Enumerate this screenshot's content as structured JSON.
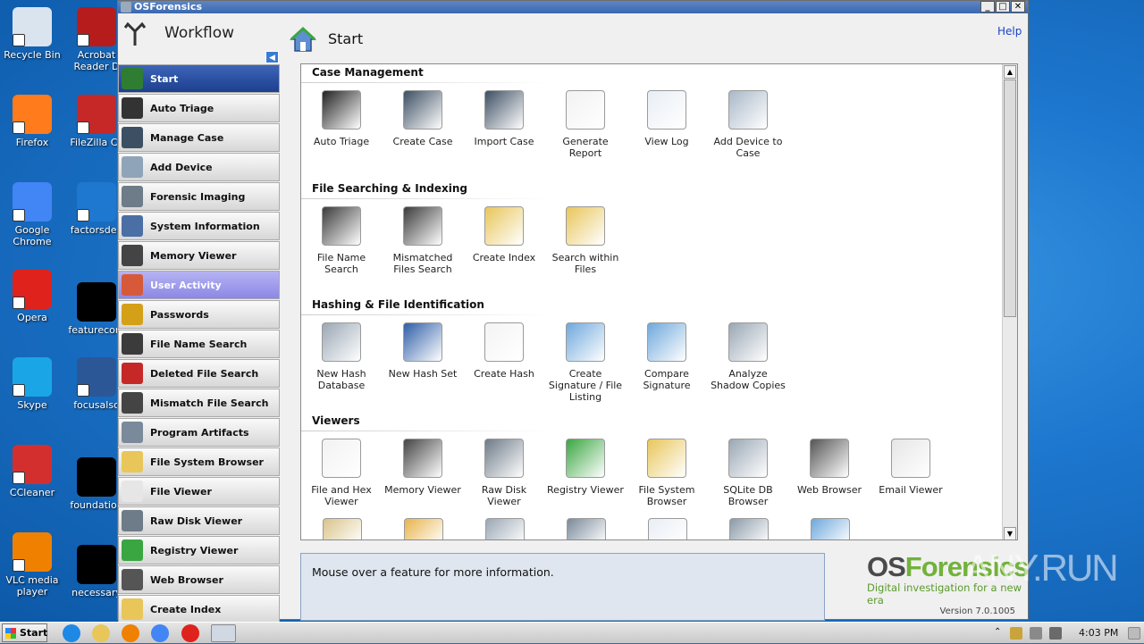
{
  "desktop": {
    "icons": [
      {
        "label": "Recycle Bin",
        "icon": "recycle-bin-icon",
        "color": "#d9e4ef"
      },
      {
        "label": "Acrobat Reader D",
        "icon": "acrobat-icon",
        "color": "#b71c1c"
      },
      {
        "label": "Firefox",
        "icon": "firefox-icon",
        "color": "#ff7b1b"
      },
      {
        "label": "FileZilla Cli",
        "icon": "filezilla-icon",
        "color": "#c62828"
      },
      {
        "label": "Google Chrome",
        "icon": "chrome-icon",
        "color": "#4285f4"
      },
      {
        "label": "factorsdee",
        "icon": "file-icon",
        "color": "#1e78cf"
      },
      {
        "label": "Opera",
        "icon": "opera-icon",
        "color": "#e0221c"
      },
      {
        "label": "featurecom",
        "icon": "file-icon",
        "color": "#000000"
      },
      {
        "label": "Skype",
        "icon": "skype-icon",
        "color": "#1aa6e6"
      },
      {
        "label": "focusalso",
        "icon": "word-document-icon",
        "color": "#2b5797"
      },
      {
        "label": "CCleaner",
        "icon": "ccleaner-icon",
        "color": "#d32f2f"
      },
      {
        "label": "foundation",
        "icon": "file-icon",
        "color": "#000000"
      },
      {
        "label": "VLC media player",
        "icon": "vlc-icon",
        "color": "#f08000"
      },
      {
        "label": "necessary",
        "icon": "file-icon",
        "color": "#000000"
      }
    ]
  },
  "window": {
    "title": "OSForensics",
    "buttons": {
      "minimize": "_",
      "maximize": "□",
      "close": "✕"
    }
  },
  "sidebar": {
    "title": "Workflow",
    "collapse_glyph": "◀",
    "items": [
      {
        "label": "Start",
        "state": "selected",
        "icon": "home-icon",
        "color": "#2e7d32"
      },
      {
        "label": "Auto Triage",
        "state": "normal",
        "icon": "fingerprint-icon",
        "color": "#333333"
      },
      {
        "label": "Manage Case",
        "state": "normal",
        "icon": "briefcase-icon",
        "color": "#3d4f63"
      },
      {
        "label": "Add Device",
        "state": "normal",
        "icon": "disc-icon",
        "color": "#8fa4b8"
      },
      {
        "label": "Forensic Imaging",
        "state": "normal",
        "icon": "drive-icon",
        "color": "#6e7b88"
      },
      {
        "label": "System Information",
        "state": "normal",
        "icon": "system-info-icon",
        "color": "#4a6fa5"
      },
      {
        "label": "Memory Viewer",
        "state": "normal",
        "icon": "memory-chip-icon",
        "color": "#444444"
      },
      {
        "label": "User Activity",
        "state": "hover",
        "icon": "user-activity-icon",
        "color": "#d65a3a"
      },
      {
        "label": "Passwords",
        "state": "normal",
        "icon": "key-icon",
        "color": "#d4a017"
      },
      {
        "label": "File Name Search",
        "state": "normal",
        "icon": "binoculars-icon",
        "color": "#3b3b3b"
      },
      {
        "label": "Deleted File Search",
        "state": "normal",
        "icon": "deleted-file-icon",
        "color": "#c62828"
      },
      {
        "label": "Mismatch File Search",
        "state": "normal",
        "icon": "mismatch-icon",
        "color": "#444444"
      },
      {
        "label": "Program Artifacts",
        "state": "normal",
        "icon": "artifacts-icon",
        "color": "#7a8a9a"
      },
      {
        "label": "File System Browser",
        "state": "normal",
        "icon": "folder-search-icon",
        "color": "#e8c65a"
      },
      {
        "label": "File Viewer",
        "state": "normal",
        "icon": "file-viewer-icon",
        "color": "#e6e6e6"
      },
      {
        "label": "Raw Disk Viewer",
        "state": "normal",
        "icon": "raw-disk-icon",
        "color": "#6e7b88"
      },
      {
        "label": "Registry Viewer",
        "state": "normal",
        "icon": "registry-icon",
        "color": "#3aa641"
      },
      {
        "label": "Web Browser",
        "state": "normal",
        "icon": "web-icon",
        "color": "#555555"
      },
      {
        "label": "Create Index",
        "state": "normal",
        "icon": "index-icon",
        "color": "#e8c65a"
      }
    ]
  },
  "main": {
    "title": "Start",
    "help_link": "Help",
    "sections": [
      {
        "title": "Case Management",
        "tiles": [
          {
            "label": "Auto Triage",
            "icon": "fingerprint-icon",
            "color": "#222222"
          },
          {
            "label": "Create Case",
            "icon": "briefcase-add-icon",
            "color": "#3d4f63"
          },
          {
            "label": "Import Case",
            "icon": "briefcase-search-icon",
            "color": "#3d4f63"
          },
          {
            "label": "Generate Report",
            "icon": "report-icon",
            "color": "#f2f2f2"
          },
          {
            "label": "View Log",
            "icon": "log-icon",
            "color": "#e9eef5"
          },
          {
            "label": "Add Device to Case",
            "icon": "disc-icon",
            "color": "#a9b8c8"
          }
        ]
      },
      {
        "title": "File Searching & Indexing",
        "tiles": [
          {
            "label": "File Name Search",
            "icon": "binoculars-icon",
            "color": "#3b3b3b"
          },
          {
            "label": "Mismatched Files Search",
            "icon": "binoculars-abc-icon",
            "color": "#3b3b3b"
          },
          {
            "label": "Create Index",
            "icon": "index-icon",
            "color": "#e8c65a"
          },
          {
            "label": "Search within Files",
            "icon": "search-files-icon",
            "color": "#e8c65a"
          }
        ]
      },
      {
        "title": "Hashing & File Identification",
        "tiles": [
          {
            "label": "New Hash Database",
            "icon": "database-new-icon",
            "color": "#9aa7b4"
          },
          {
            "label": "New Hash Set",
            "icon": "book-icon",
            "color": "#2f5ea8"
          },
          {
            "label": "Create Hash",
            "icon": "barcode-icon",
            "color": "#f4f4f4"
          },
          {
            "label": "Create Signature / File Listing",
            "icon": "signature-icon",
            "color": "#6fa8dc"
          },
          {
            "label": "Compare Signature",
            "icon": "compare-signature-icon",
            "color": "#6fa8dc"
          },
          {
            "label": "Analyze Shadow Copies",
            "icon": "shadow-copies-icon",
            "color": "#9aa7b4"
          }
        ]
      },
      {
        "title": "Viewers",
        "tiles": [
          {
            "label": "File and Hex Viewer",
            "icon": "file-hex-icon",
            "color": "#f2f2f2"
          },
          {
            "label": "Memory Viewer",
            "icon": "memory-chip-icon",
            "color": "#444444"
          },
          {
            "label": "Raw Disk Viewer",
            "icon": "raw-disk-icon",
            "color": "#6e7b88"
          },
          {
            "label": "Registry Viewer",
            "icon": "registry-icon",
            "color": "#3aa641"
          },
          {
            "label": "File System Browser",
            "icon": "folder-search-icon",
            "color": "#e8c65a"
          },
          {
            "label": "SQLite DB Browser",
            "icon": "database-icon",
            "color": "#9aa7b4"
          },
          {
            "label": "Web Browser",
            "icon": "web-icon",
            "color": "#555555"
          },
          {
            "label": "Email Viewer",
            "icon": "email-icon",
            "color": "#e6e6e6"
          }
        ]
      }
    ],
    "partial_row_icons": [
      {
        "icon": "clipboard-icon",
        "color": "#d9c48a"
      },
      {
        "icon": "picture-icon",
        "color": "#e8b44a"
      },
      {
        "icon": "database-icon",
        "color": "#9aa7b4"
      },
      {
        "icon": "printer-icon",
        "color": "#7a8a9a"
      },
      {
        "icon": "document-icon",
        "color": "#e9eef5"
      },
      {
        "icon": "list-icon",
        "color": "#8a9aa8"
      },
      {
        "icon": "table-icon",
        "color": "#6fa8dc"
      }
    ],
    "info_text": "Mouse over a feature for more information."
  },
  "brand": {
    "name_part1": "OS",
    "name_part2": "Forensics",
    "tagline": "Digital investigation for a new era",
    "version": "Version 7.0.1005"
  },
  "watermark": "ANY.RUN",
  "taskbar": {
    "start_label": "Start",
    "pinned": [
      {
        "icon": "ie-icon",
        "color": "#1e88e5"
      },
      {
        "icon": "explorer-icon",
        "color": "#e8c65a"
      },
      {
        "icon": "media-player-icon",
        "color": "#f08000"
      },
      {
        "icon": "chrome-icon",
        "color": "#4285f4"
      },
      {
        "icon": "opera-icon",
        "color": "#e0221c"
      },
      {
        "icon": "osforensics-icon",
        "color": "#cfd8e3"
      }
    ],
    "clock": "4:03 PM"
  }
}
